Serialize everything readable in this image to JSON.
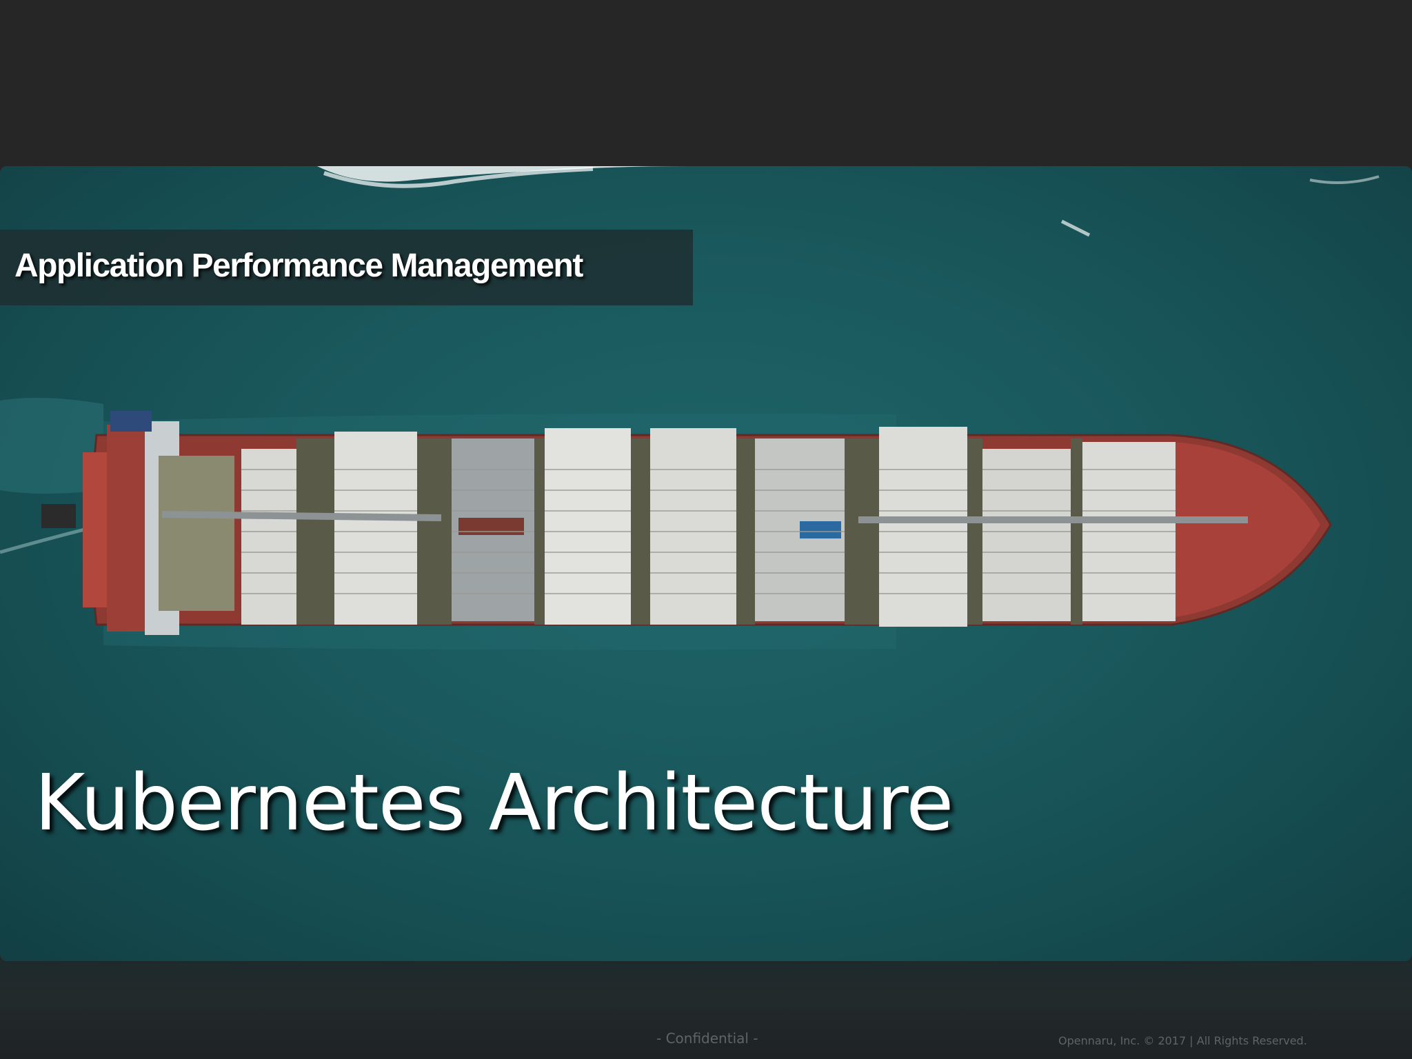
{
  "slide": {
    "subtitle": "Application Performance Management",
    "title": "Kubernetes Architecture",
    "footer": {
      "confidential": "- Confidential -",
      "copyright": "Opennaru, Inc. ©  2017 | All Rights Reserved."
    },
    "background_image": "aerial-container-ship-photo"
  },
  "colors": {
    "page_background": "#262626",
    "sea": "#1a5a5e",
    "ship_deck": "#a8413a",
    "container": "#dcdcd8",
    "text": "#ffffff",
    "footer_text": "#5e6566"
  }
}
